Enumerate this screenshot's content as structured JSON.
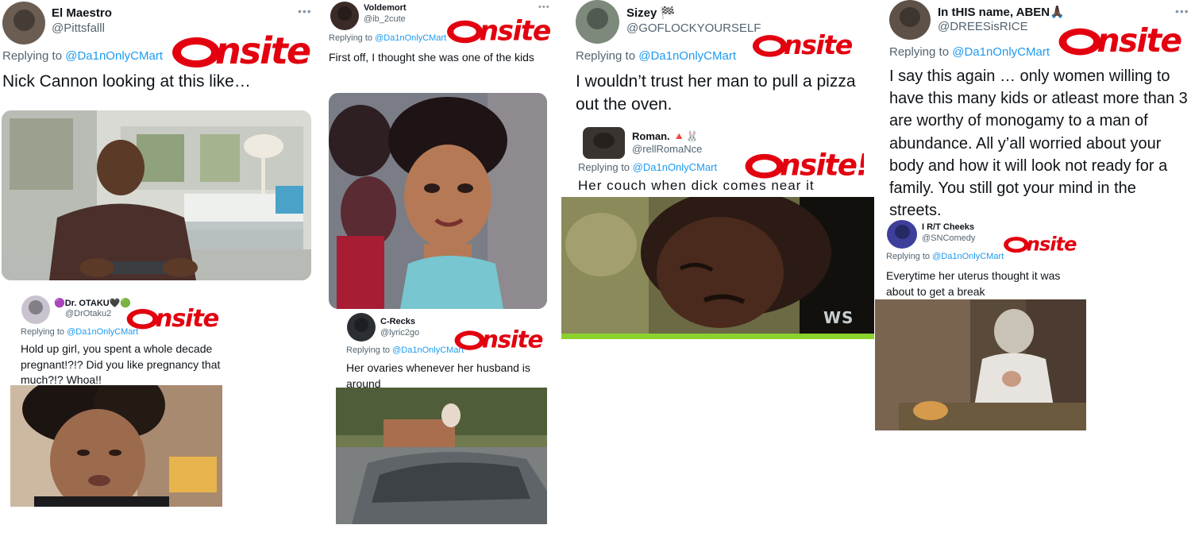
{
  "brand": {
    "sticker_text": "Onsite!",
    "sticker_red": "#e3000f",
    "link_color": "#1d9bf0",
    "handle_color": "#536471"
  },
  "reply_prefix": "Replying to",
  "reply_target": "@Da1nOnlyCMart",
  "tweets": [
    {
      "name": "El Maestro",
      "handle": "@Pittsfalll",
      "text": "Nick Cannon looking at this like…",
      "media_icon": "man-on-couch-image"
    },
    {
      "name": "Voldemort",
      "handle": "@ib_2cute",
      "text": "First off, I thought she was one of the kids",
      "media_icon": "cartoon-dolls-image"
    },
    {
      "name": "Sizey 🏁",
      "handle": "@GOFLOCKYOURSELF",
      "text": "I wouldn’t trust her man to pull a pizza out the oven.",
      "media_icon": ""
    },
    {
      "name": "In tHIS name, ABEN🙏🏿",
      "handle": "@DREESisRICE",
      "text": "I say this again … only women willing to have this many kids or atleast more than 3 are worthy of monogamy to a man of abundance. All y’all worried about your body and how it will look not ready for a family. You still got your mind in the streets.",
      "media_icon": ""
    },
    {
      "name": "🟣Dr. OTAKU🖤🟢",
      "handle": "@DrOtaku2",
      "text": "Hold up girl, you spent a whole decade pregnant!?!? Did you like pregnancy that much?!? Whoa!!",
      "media_icon": "woman-talking-image"
    },
    {
      "name": "C-Recks",
      "handle": "@lyric2go",
      "text": "Her ovaries whenever her husband is around",
      "media_icon": "car-window-image"
    },
    {
      "name": "Roman. 🔺🐰",
      "handle": "@rellRomaNce",
      "text": "Her couch when dick comes near it",
      "media_icon": "crying-man-image",
      "watermark": "WS"
    },
    {
      "name": "I R/T Cheeks",
      "handle": "@SNComedy",
      "text": "Everytime her uterus thought it was about to get a break",
      "media_icon": "old-woman-praying-image"
    }
  ]
}
